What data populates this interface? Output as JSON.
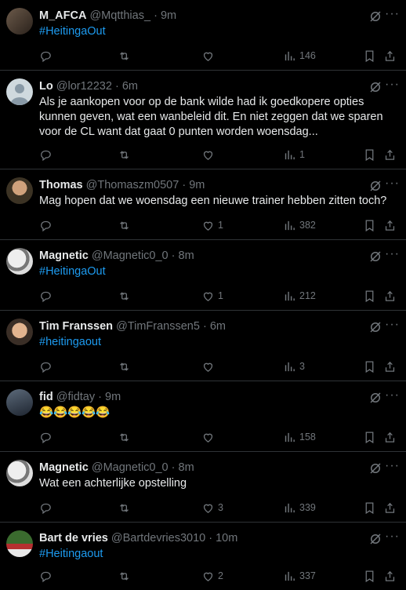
{
  "colors": {
    "background": "#000000",
    "text": "#e7e9ea",
    "muted": "#71767b",
    "link": "#1d9bf0",
    "divider": "#2f3336"
  },
  "icons": {
    "reply": "reply-icon",
    "retweet": "retweet-icon",
    "like": "like-icon",
    "views": "views-icon",
    "bookmark": "bookmark-icon",
    "share": "share-icon",
    "grok": "grok-icon",
    "more": "more-icon"
  },
  "tweets": [
    {
      "name": "M_AFCA",
      "handle": "@Mqtthias_",
      "dot": "·",
      "time": "9m",
      "text": "#HeitingaOut",
      "hashtag": true,
      "likes": "",
      "views": "146",
      "more": "···"
    },
    {
      "name": "Lo",
      "handle": "@lor12232",
      "dot": "·",
      "time": "6m",
      "text": "Als je aankopen voor op de bank wilde had ik goedkopere opties kunnen geven, wat een wanbeleid dit. En niet zeggen dat we sparen voor de CL want dat gaat 0 punten worden woensdag...",
      "hashtag": false,
      "likes": "",
      "views": "1",
      "more": "···"
    },
    {
      "name": "Thomas",
      "handle": "@Thomaszm0507",
      "dot": "·",
      "time": "9m",
      "text": "Mag hopen dat we woensdag een nieuwe trainer hebben zitten toch?",
      "hashtag": false,
      "likes": "1",
      "views": "382",
      "more": "···"
    },
    {
      "name": "Magnetic",
      "handle": "@Magnetic0_0",
      "dot": "·",
      "time": "8m",
      "text": "#HeitingaOut",
      "hashtag": true,
      "likes": "1",
      "views": "212",
      "more": "···"
    },
    {
      "name": "Tim Franssen",
      "handle": "@TimFranssen5",
      "dot": "·",
      "time": "6m",
      "text": "#heitingaout",
      "hashtag": true,
      "likes": "",
      "views": "3",
      "more": "···"
    },
    {
      "name": "fid",
      "handle": "@fidtay",
      "dot": "·",
      "time": "9m",
      "text": "😂😂😂😂😂",
      "hashtag": false,
      "likes": "",
      "views": "158",
      "more": "···"
    },
    {
      "name": "Magnetic",
      "handle": "@Magnetic0_0",
      "dot": "·",
      "time": "8m",
      "text": "Wat een achterlijke opstelling",
      "hashtag": false,
      "likes": "3",
      "views": "339",
      "more": "···"
    },
    {
      "name": "Bart de vries",
      "handle": "@Bartdevries3010",
      "dot": "·",
      "time": "10m",
      "text": "#Heitingaout",
      "hashtag": true,
      "likes": "2",
      "views": "337",
      "more": "···"
    }
  ]
}
